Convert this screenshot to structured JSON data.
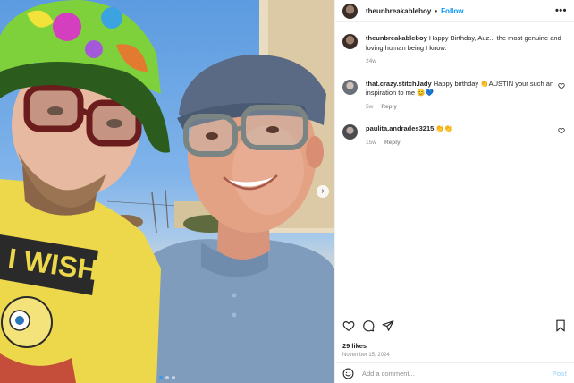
{
  "post": {
    "owner_username": "theunbreakableboy",
    "follow_label": "Follow",
    "more_label": "•••",
    "separator": "•"
  },
  "photo": {
    "shirt_text": "I WISH",
    "next_arrow": "›",
    "slide_count": 3,
    "active_slide": 1
  },
  "caption": {
    "username": "theunbreakableboy",
    "text": "Happy Birthday, Auz... the most genuine and loving human being I know.",
    "age": "24w"
  },
  "comments": [
    {
      "username": "that.crazy.stitch.lady",
      "text": "Happy birthday 👏AUSTIN your such an inspiration to me 😊💙",
      "age": "5w",
      "reply_label": "Reply"
    },
    {
      "username": "paulita.andrades3215",
      "text": "👏👏",
      "age": "15w",
      "reply_label": "Reply"
    }
  ],
  "engagement": {
    "likes": "29 likes",
    "date": "November 15, 2024"
  },
  "add_comment": {
    "placeholder": "Add a comment...",
    "post_label": "Post"
  },
  "icons": [
    "more-icon",
    "heart-icon",
    "comment-icon",
    "share-icon",
    "save-icon",
    "emoji-icon",
    "next-arrow-icon"
  ],
  "colors": {
    "accent": "#0095f6",
    "post_disabled": "#b2dffc",
    "muted": "#8e8e8e",
    "text": "#262626"
  }
}
